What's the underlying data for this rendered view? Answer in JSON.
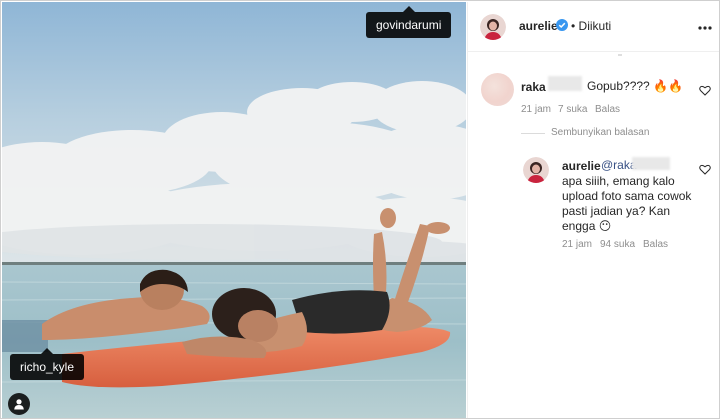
{
  "photo": {
    "tags": [
      {
        "id": "tag-govindarumi",
        "label": "govindarumi"
      },
      {
        "id": "tag-richo",
        "label": "richo_kyle"
      }
    ]
  },
  "header": {
    "username": "aurelie",
    "separator": "•",
    "follow_status": "Diikuti",
    "verified_color": "#3897f0"
  },
  "comments": [
    {
      "username": "raka",
      "text": "Gopub????",
      "emoji": "🔥🔥",
      "time": "21 jam",
      "likes": "7 suka",
      "reply_label": "Balas"
    }
  ],
  "hide_replies_label": "Sembunyikan balasan",
  "reply": {
    "username": "aurelie",
    "mention": "@raka",
    "lines": [
      "apa siiih, emang kalo",
      "upload foto sama cowok",
      "pasti jadian ya? Kan",
      "engga 😶"
    ],
    "time": "21 jam",
    "likes": "94 suka",
    "reply_label": "Balas"
  },
  "colors": {
    "text": "#262626",
    "muted": "#8e8e8e",
    "mention": "#385185",
    "board": "#e8704e",
    "tag_bg": "#000000"
  }
}
